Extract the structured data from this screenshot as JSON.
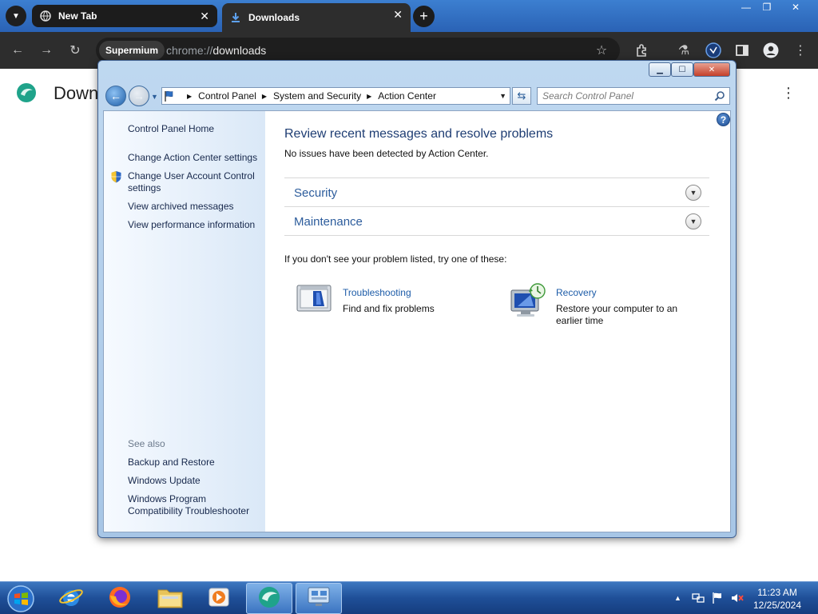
{
  "browser": {
    "tabs": [
      {
        "label": "New Tab"
      },
      {
        "label": "Downloads"
      }
    ],
    "site_chip": "Supermium",
    "url_scheme": "chrome://",
    "url_host": "downloads",
    "page_title": "Downl"
  },
  "window": {
    "breadcrumbs": [
      "Control Panel",
      "System and Security",
      "Action Center"
    ],
    "search_placeholder": "Search Control Panel"
  },
  "left_pane": {
    "home": "Control Panel Home",
    "links": [
      "Change Action Center settings",
      "Change User Account Control settings",
      "View archived messages",
      "View performance information"
    ],
    "see_also_label": "See also",
    "see_also": [
      "Backup and Restore",
      "Windows Update",
      "Windows Program Compatibility Troubleshooter"
    ]
  },
  "main": {
    "title": "Review recent messages and resolve problems",
    "status": "No issues have been detected by Action Center.",
    "sections": [
      "Security",
      "Maintenance"
    ],
    "prompt": "If you don't see your problem listed, try one of these:",
    "tools": [
      {
        "title": "Troubleshooting",
        "desc": "Find and fix problems"
      },
      {
        "title": "Recovery",
        "desc": "Restore your computer to an earlier time"
      }
    ]
  },
  "taskbar": {
    "time": "11:23 AM",
    "date": "12/25/2024"
  },
  "colors": {
    "accent": "#1d5ca8",
    "heading": "#1e3d73",
    "taskbar": "#1f4f98"
  }
}
